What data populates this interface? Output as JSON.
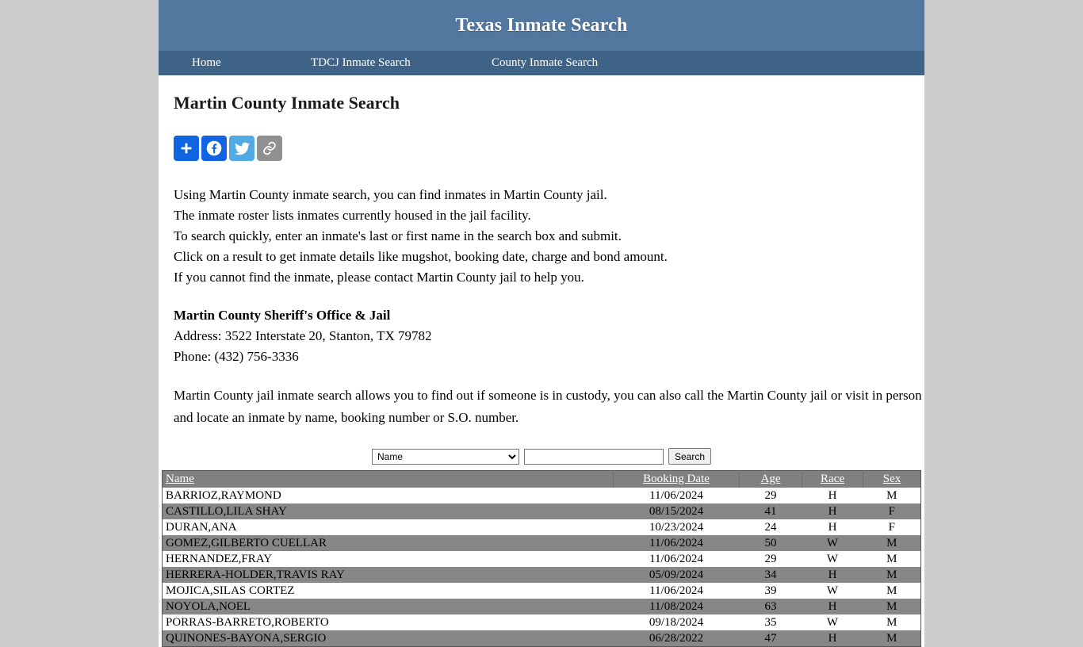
{
  "site": {
    "title": "Texas Inmate Search",
    "header_bg": "#5378a0",
    "nav_bg": "#3e6386"
  },
  "nav": {
    "items": [
      {
        "label": "Home",
        "name": "nav-home"
      },
      {
        "label": "TDCJ Inmate Search",
        "name": "nav-tdcj-inmate-search"
      },
      {
        "label": "County Inmate Search",
        "name": "nav-county-inmate-search"
      }
    ]
  },
  "page": {
    "title": "Martin County Inmate Search"
  },
  "share": {
    "buttons": [
      {
        "name": "addthis-share-button",
        "icon": "plus-icon",
        "color": "#0f64e0"
      },
      {
        "name": "facebook-share-button",
        "icon": "facebook-icon",
        "color": "#1263e2"
      },
      {
        "name": "twitter-share-button",
        "icon": "twitter-icon",
        "color": "#52aae4"
      },
      {
        "name": "copy-link-share-button",
        "icon": "link-icon",
        "color": "#909090"
      }
    ]
  },
  "intro": {
    "lines": [
      "Using Martin County inmate search, you can find inmates in Martin County jail.",
      "The inmate roster lists inmates currently housed in the jail facility.",
      "To search quickly, enter an inmate's last or first name in the search box and submit.",
      "Click on a result to get inmate details like mugshot, booking date, charge and bond amount.",
      "If you cannot find the inmate, please contact Martin County jail to help you."
    ]
  },
  "office": {
    "name": "Martin County Sheriff's Office & Jail",
    "address": "Address: 3522 Interstate 20, Stanton, TX 79782",
    "phone": "Phone: (432) 756-3336"
  },
  "lead": "Martin County jail inmate search allows you to find out if someone is in custody, you can also call the Martin County jail or visit in person and locate an inmate by name, booking number or S.O. number.",
  "search": {
    "select_value": "Name",
    "select_options": [
      "Name"
    ],
    "input_value": "",
    "input_placeholder": "",
    "button_label": "Search"
  },
  "results": {
    "columns": [
      {
        "label": "Name",
        "key": "name"
      },
      {
        "label": "Booking Date",
        "key": "booking_date"
      },
      {
        "label": "Age",
        "key": "age"
      },
      {
        "label": "Race",
        "key": "race"
      },
      {
        "label": "Sex",
        "key": "sex"
      }
    ],
    "rows": [
      {
        "name": "BARRIOZ,RAYMOND",
        "booking_date": "11/06/2024",
        "age": "29",
        "race": "H",
        "sex": "M"
      },
      {
        "name": "CASTILLO,LILA SHAY",
        "booking_date": "08/15/2024",
        "age": "41",
        "race": "H",
        "sex": "F"
      },
      {
        "name": "DURAN,ANA",
        "booking_date": "10/23/2024",
        "age": "24",
        "race": "H",
        "sex": "F"
      },
      {
        "name": "GOMEZ,GILBERTO CUELLAR",
        "booking_date": "11/06/2024",
        "age": "50",
        "race": "W",
        "sex": "M"
      },
      {
        "name": "HERNANDEZ,FRAY",
        "booking_date": "11/06/2024",
        "age": "29",
        "race": "W",
        "sex": "M"
      },
      {
        "name": "HERRERA-HOLDER,TRAVIS RAY",
        "booking_date": "05/09/2024",
        "age": "34",
        "race": "H",
        "sex": "M"
      },
      {
        "name": "MOJICA,SILAS CORTEZ",
        "booking_date": "11/06/2024",
        "age": "39",
        "race": "W",
        "sex": "M"
      },
      {
        "name": "NOYOLA,NOEL",
        "booking_date": "11/08/2024",
        "age": "63",
        "race": "H",
        "sex": "M"
      },
      {
        "name": "PORRAS-BARRETO,ROBERTO",
        "booking_date": "09/18/2024",
        "age": "35",
        "race": "W",
        "sex": "M"
      },
      {
        "name": "QUINONES-BAYONA,SERGIO",
        "booking_date": "06/28/2022",
        "age": "47",
        "race": "H",
        "sex": "M"
      }
    ]
  }
}
